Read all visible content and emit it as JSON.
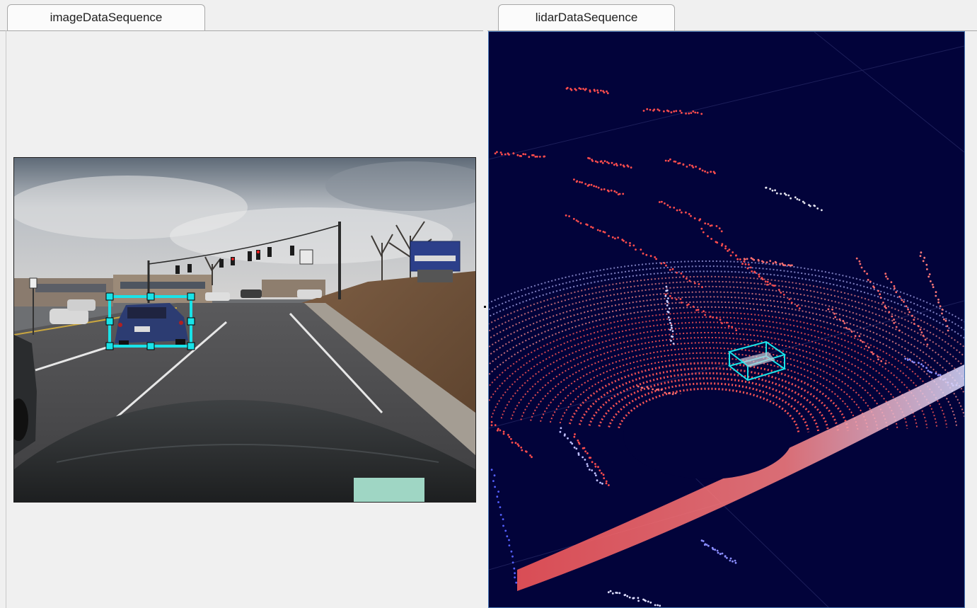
{
  "tabs": {
    "left": "imageDataSequence",
    "right": "lidarDataSequence"
  },
  "colors": {
    "bbox": "#19e3e8",
    "lidar_background": "#02033a",
    "lidar_points_near": "#ff4d4d",
    "lidar_points_far": "#8a8dff"
  }
}
